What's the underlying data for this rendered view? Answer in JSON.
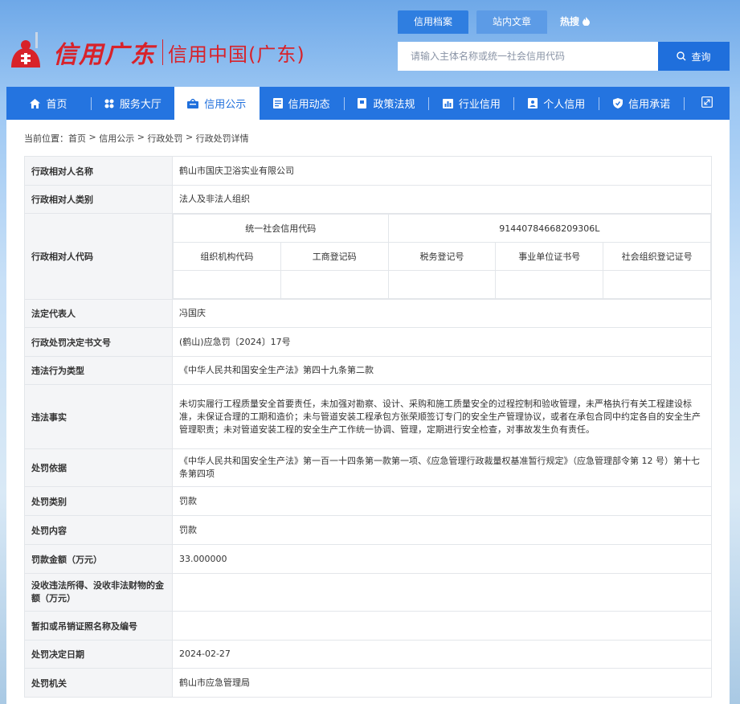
{
  "site": {
    "logo_main": "信用广东",
    "logo_sub": "信用中国(广东)"
  },
  "search": {
    "tabs": [
      "信用档案",
      "站内文章"
    ],
    "hot_label": "热搜",
    "placeholder": "请输入主体名称或统一社会信用代码",
    "button_label": "查询"
  },
  "nav": {
    "items": [
      {
        "label": "首页",
        "icon": "home-icon"
      },
      {
        "label": "服务大厅",
        "icon": "grid-icon"
      },
      {
        "label": "信用公示",
        "icon": "megaphone-icon"
      },
      {
        "label": "信用动态",
        "icon": "news-icon"
      },
      {
        "label": "政策法规",
        "icon": "book-icon"
      },
      {
        "label": "行业信用",
        "icon": "chart-icon"
      },
      {
        "label": "个人信用",
        "icon": "id-card-icon"
      },
      {
        "label": "信用承诺",
        "icon": "shield-check-icon"
      }
    ],
    "active_index": 2,
    "end_icon": "expand-icon"
  },
  "breadcrumb": {
    "prefix": "当前位置：",
    "items": [
      "首页",
      "信用公示",
      "行政处罚",
      "行政处罚详情"
    ],
    "separator": ">"
  },
  "detail": {
    "name_label": "行政相对人名称",
    "name_value": "鹤山市国庆卫浴实业有限公司",
    "category_label": "行政相对人类别",
    "category_value": "法人及非法人组织",
    "code_label": "行政相对人代码",
    "uscc_label": "统一社会信用代码",
    "uscc_value": "91440784668209306L",
    "code_headers": [
      "组织机构代码",
      "工商登记码",
      "税务登记号",
      "事业单位证书号",
      "社会组织登记证号"
    ],
    "code_values": [
      "",
      "",
      "",
      "",
      ""
    ],
    "legal_rep_label": "法定代表人",
    "legal_rep_value": "冯国庆",
    "doc_no_label": "行政处罚决定书文号",
    "doc_no_value": "(鹤山)应急罚〔2024〕17号",
    "violation_type_label": "违法行为类型",
    "violation_type_value": "《中华人民共和国安全生产法》第四十九条第二款",
    "facts_label": "违法事实",
    "facts_value": "未切实履行工程质量安全首要责任，未加强对勘察、设计、采购和施工质量安全的过程控制和验收管理，未严格执行有关工程建设标准，未保证合理的工期和造价；未与管道安装工程承包方张荣顺签订专门的安全生产管理协议，或者在承包合同中约定各自的安全生产管理职责；未对管道安装工程的安全生产工作统一协调、管理，定期进行安全检查，对事故发生负有责任。",
    "basis_label": "处罚依据",
    "basis_value": "《中华人民共和国安全生产法》第一百一十四条第一款第一项、《应急管理行政裁量权基准暂行规定》（应急管理部令第 12 号）第十七条第四项",
    "punish_type_label": "处罚类别",
    "punish_type_value": "罚款",
    "punish_content_label": "处罚内容",
    "punish_content_value": "罚款",
    "fine_label": "罚款金额（万元）",
    "fine_value": "33.000000",
    "confiscate_label": "没收违法所得、没收非法财物的金额（万元）",
    "confiscate_value": "",
    "license_label": "暂扣或吊销证照名称及编号",
    "license_value": "",
    "date_label": "处罚决定日期",
    "date_value": "2024-02-27",
    "authority_label": "处罚机关",
    "authority_value": "鹤山市应急管理局"
  },
  "colors": {
    "brand_red": "#d8222a",
    "nav_blue": "#2474e0",
    "accent_blue": "#1f6fdc"
  }
}
